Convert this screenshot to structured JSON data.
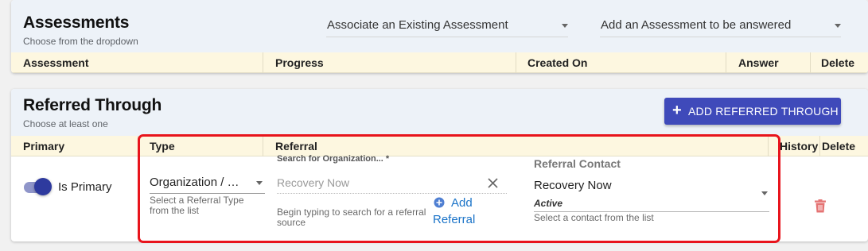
{
  "colors": {
    "accent": "#3f4aba",
    "header_bg": "#edf2f8",
    "table_header_bg": "#fdf7e0",
    "highlight_border": "#e8141c",
    "delete_red": "#e57373",
    "link_blue": "#1a73c8"
  },
  "assessments": {
    "title": "Assessments",
    "subtitle": "Choose from the dropdown",
    "associate_select": "Associate an Existing Assessment",
    "add_select": "Add an Assessment to be answered",
    "columns": [
      "Assessment",
      "Progress",
      "Created On",
      "Answer",
      "Delete"
    ]
  },
  "referred": {
    "title": "Referred Through",
    "subtitle": "Choose at least one",
    "add_button": "ADD REFERRED THROUGH",
    "columns": [
      "Primary",
      "Type",
      "Referral",
      "History",
      "Delete"
    ],
    "row": {
      "primary_label": "Is Primary",
      "primary_on": true,
      "type_value": "Organization / …",
      "type_helper": "Select a Referral Type from the list",
      "search_label": "Search for Organization... *",
      "search_value": "Recovery Now",
      "search_helper": "Begin typing to search for a referral source",
      "add_referral": "Add Referral",
      "contact_label": "Referral Contact",
      "contact_value": "Recovery Now",
      "contact_status": "Active",
      "contact_helper": "Select a contact from the list"
    }
  },
  "icons": {
    "plus": "plus-icon",
    "clear": "close-icon",
    "add_circle": "add-circle-icon",
    "dropdown": "chevron-down-icon",
    "delete": "trash-icon"
  }
}
